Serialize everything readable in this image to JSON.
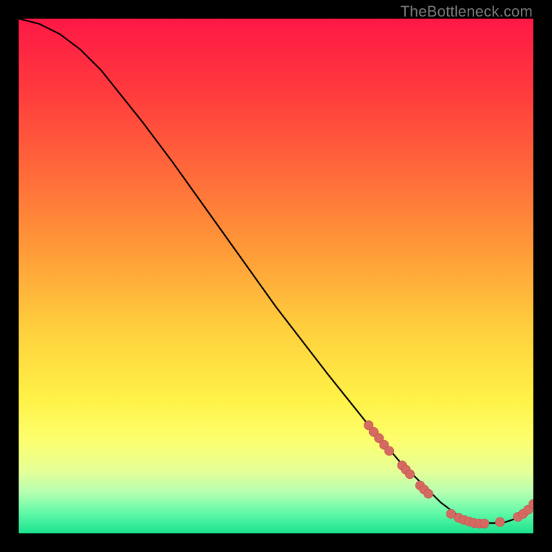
{
  "watermark": "TheBottleneck.com",
  "colors": {
    "curve": "#000000",
    "marker_fill": "#d56a62",
    "marker_stroke": "#c85b53",
    "gradient_top": "#ff1846",
    "gradient_bottom": "#1be28e"
  },
  "chart_data": {
    "type": "line",
    "title": "",
    "xlabel": "",
    "ylabel": "",
    "xlim": [
      0,
      100
    ],
    "ylim": [
      0,
      100
    ],
    "grid": false,
    "legend": false,
    "series": [
      {
        "name": "curve",
        "x": [
          0,
          4,
          8,
          12,
          16,
          20,
          24,
          30,
          40,
          50,
          60,
          68,
          74,
          78,
          82,
          86,
          90,
          94,
          97,
          100
        ],
        "y": [
          100,
          99,
          97,
          94,
          90,
          85,
          80,
          72,
          58,
          44,
          31,
          21,
          14,
          10,
          6,
          3,
          2,
          2,
          3,
          6
        ]
      }
    ],
    "markers": [
      {
        "x": 68.0,
        "y": 21.0
      },
      {
        "x": 69.0,
        "y": 19.7
      },
      {
        "x": 70.0,
        "y": 18.5
      },
      {
        "x": 71.0,
        "y": 17.2
      },
      {
        "x": 72.0,
        "y": 16.0
      },
      {
        "x": 74.5,
        "y": 13.2
      },
      {
        "x": 75.2,
        "y": 12.4
      },
      {
        "x": 76.0,
        "y": 11.5
      },
      {
        "x": 78.0,
        "y": 9.3
      },
      {
        "x": 78.8,
        "y": 8.5
      },
      {
        "x": 79.6,
        "y": 7.7
      },
      {
        "x": 84.0,
        "y": 3.8
      },
      {
        "x": 85.5,
        "y": 3.0
      },
      {
        "x": 86.5,
        "y": 2.6
      },
      {
        "x": 87.5,
        "y": 2.3
      },
      {
        "x": 88.5,
        "y": 2.0
      },
      {
        "x": 89.5,
        "y": 1.9
      },
      {
        "x": 90.5,
        "y": 1.9
      },
      {
        "x": 93.5,
        "y": 2.2
      },
      {
        "x": 97.0,
        "y": 3.2
      },
      {
        "x": 98.0,
        "y": 3.8
      },
      {
        "x": 99.0,
        "y": 4.6
      },
      {
        "x": 100.0,
        "y": 5.7
      }
    ]
  }
}
